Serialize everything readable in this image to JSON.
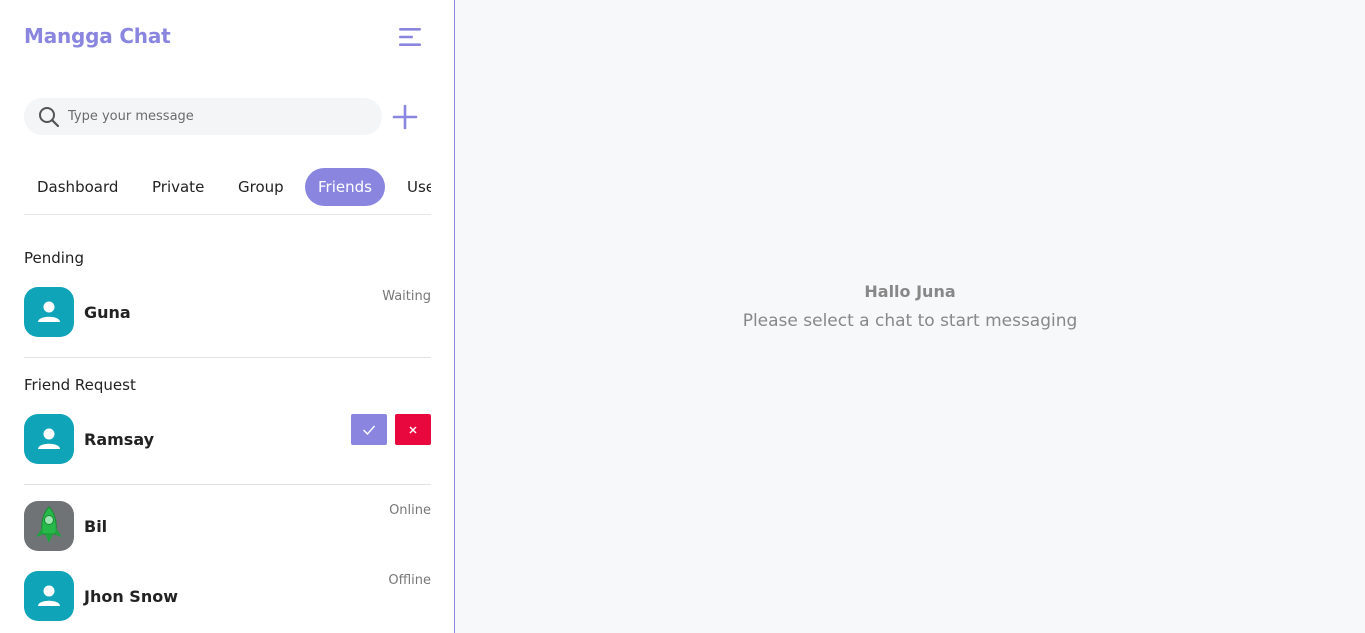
{
  "app": {
    "title": "Mangga Chat"
  },
  "search": {
    "placeholder": "Type your message"
  },
  "tabs": [
    {
      "label": "Dashboard"
    },
    {
      "label": "Private"
    },
    {
      "label": "Group"
    },
    {
      "label": "Friends",
      "active": true
    },
    {
      "label": "Use"
    }
  ],
  "sections": {
    "pending": {
      "title": "Pending",
      "items": [
        {
          "name": "Guna",
          "status": "Waiting",
          "avatar": "user-icon"
        }
      ]
    },
    "requests": {
      "title": "Friend Request",
      "items": [
        {
          "name": "Ramsay",
          "avatar": "user-icon",
          "accept_icon": "check-icon",
          "reject_icon": "x-icon"
        }
      ]
    },
    "friends": {
      "items": [
        {
          "name": "Bil",
          "status": "Online",
          "avatar": "rocket-avatar"
        },
        {
          "name": "Jhon Snow",
          "status": "Offline",
          "avatar": "user-icon"
        }
      ]
    }
  },
  "main": {
    "greeting": "Hallo Juna",
    "hint": "Please select a chat to start messaging"
  },
  "colors": {
    "accent": "#8a86e0",
    "avatar": "#10a4b8",
    "danger": "#e8083e",
    "main_bg": "#f7f8fa"
  }
}
